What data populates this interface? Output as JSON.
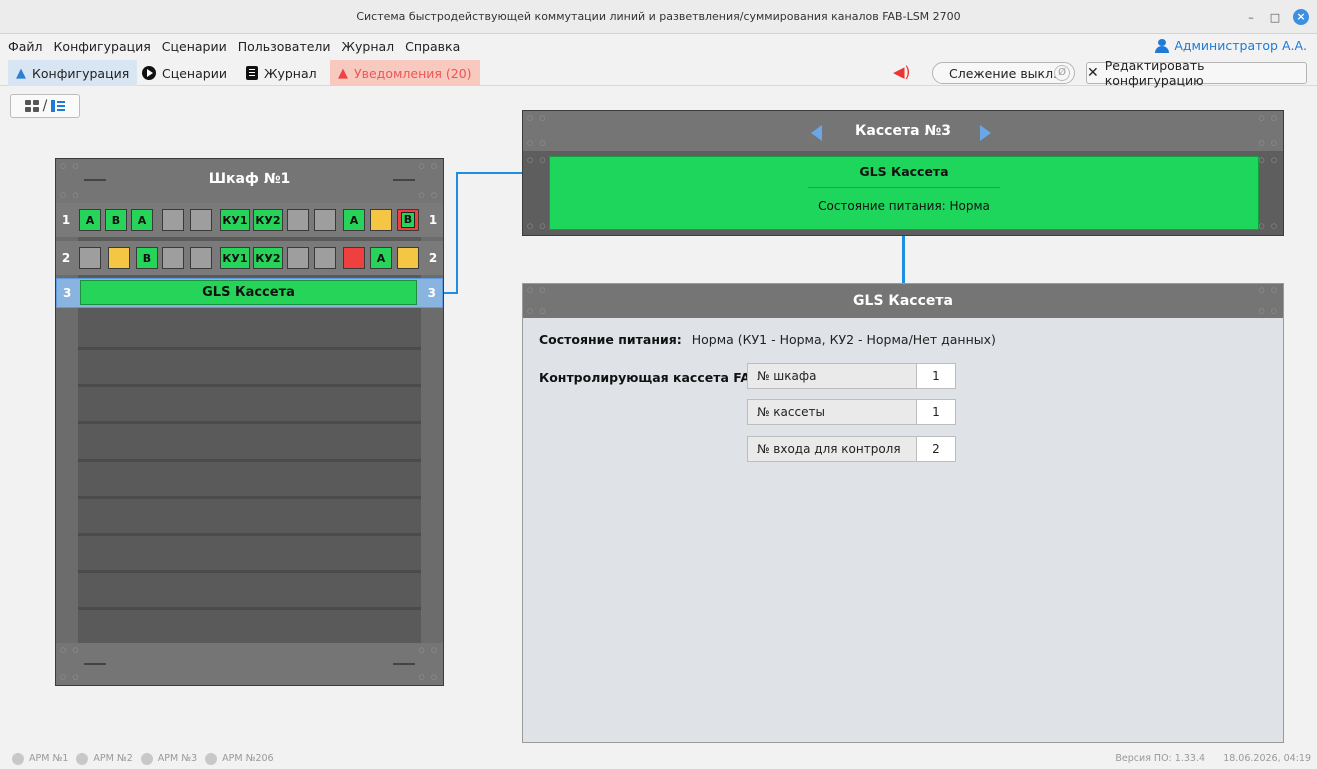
{
  "window": {
    "title": "Система быстродействующей коммутации линий и разветвления/суммирования каналов FAB-LSM 2700"
  },
  "menu": [
    "Файл",
    "Конфигурация",
    "Сценарии",
    "Пользователи",
    "Журнал",
    "Справка"
  ],
  "user": "Администратор А.А.",
  "tabs": {
    "config": "Конфигурация",
    "scenarios": "Сценарии",
    "journal": "Журнал",
    "notifications": "Уведомления (20)"
  },
  "toolbar": {
    "tracking": "Слежение выкл.",
    "edit": "Редактировать конфигурацию"
  },
  "rack": {
    "title": "Шкаф №1",
    "row1": {
      "num": "1",
      "modules": [
        "A",
        "B",
        "A",
        "",
        "",
        "КУ1",
        "КУ2",
        "",
        "",
        "A",
        "",
        "B"
      ]
    },
    "row2": {
      "num": "2",
      "modules": [
        "",
        "",
        "B",
        "",
        "",
        "КУ1",
        "КУ2",
        "",
        "",
        "",
        "A",
        ""
      ]
    },
    "row3": {
      "num": "3",
      "label": "GLS Кассета"
    }
  },
  "cassette": {
    "title": "Кассета №3",
    "name": "GLS Кассета",
    "status": "Состояние питания: Норма"
  },
  "detail": {
    "title": "GLS Кассета",
    "power_label": "Состояние питания:",
    "power_value": "Норма (КУ1 - Норма, КУ2 - Норма/Нет данных)",
    "control_label": "Контролирующая кассета FAB:",
    "fields": [
      {
        "label": "№ шкафа",
        "value": "1"
      },
      {
        "label": "№ кассеты",
        "value": "1"
      },
      {
        "label": "№ входа для контроля",
        "value": "2"
      }
    ]
  },
  "statusbar": {
    "arms": [
      "АРМ №1",
      "АРМ №2",
      "АРМ №3",
      "АРМ №206"
    ],
    "version": "Версия ПО: 1.33.4",
    "datetime": "18.06.2026, 04:19"
  }
}
